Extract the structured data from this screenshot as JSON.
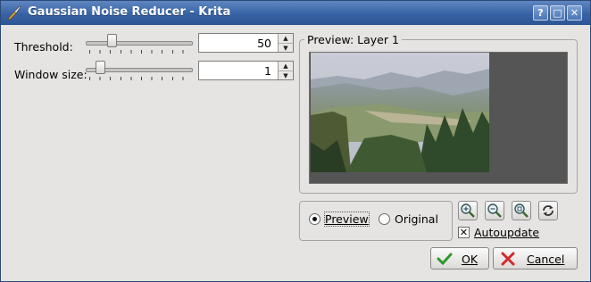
{
  "window": {
    "title": "Gaussian Noise Reducer - Krita",
    "title_buttons": {
      "help": "?",
      "maximize": "□",
      "close": "✕"
    }
  },
  "params": {
    "threshold": {
      "label": "Threshold:",
      "value": "50",
      "slider_fraction": 0.22
    },
    "window_size": {
      "label": "Window size:",
      "value": "1",
      "slider_fraction": 0.1
    }
  },
  "preview": {
    "group_title": "Preview: Layer 1",
    "mode": {
      "preview_label": "Preview",
      "original_label": "Original",
      "selected": "preview"
    },
    "tools": [
      "zoom-in-icon",
      "zoom-out-icon",
      "zoom-reset-icon",
      "refresh-icon"
    ],
    "autoupdate": {
      "label": "Autoupdate",
      "checked": true,
      "mark": "✕"
    }
  },
  "buttons": {
    "ok": "OK",
    "cancel": "Cancel"
  },
  "colors": {
    "titlebar": "#3763a5",
    "ok_check": "#2a9a2a",
    "cancel_x": "#d22a2a"
  }
}
